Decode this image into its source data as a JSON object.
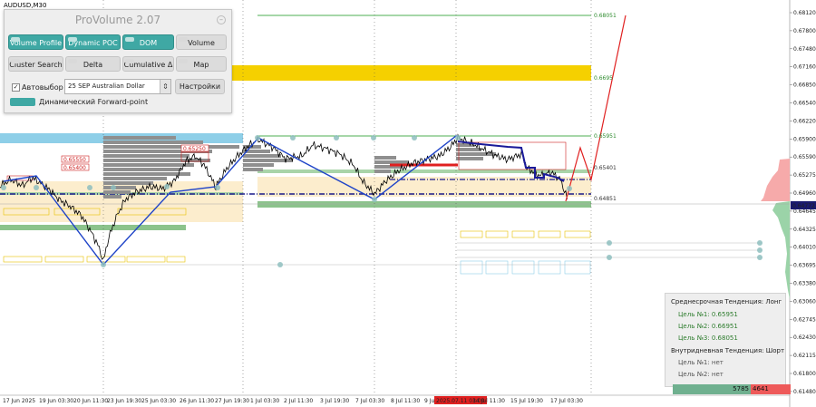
{
  "symbol": "AUDUSD,M30",
  "panel": {
    "title": "ProVolume 2.07",
    "buttons": [
      {
        "label": "Volume Profile",
        "style": "teal"
      },
      {
        "label": "Dynamic POC",
        "style": "teal"
      },
      {
        "label": "DOM",
        "style": "teal"
      },
      {
        "label": "Volume",
        "style": "gray"
      },
      {
        "label": "Cluster Search",
        "style": "gray"
      },
      {
        "label": "Delta",
        "style": "gray"
      },
      {
        "label": "Cumulative Δ",
        "style": "gray"
      },
      {
        "label": "Map",
        "style": "gray"
      }
    ],
    "auto_select_label": "Автовыбор",
    "auto_select_checked": true,
    "contract_value": "25 SEP Australian Dollar",
    "settings_label": "Настройки",
    "forward_point_label": "Динамический Forward-point"
  },
  "price_axis": {
    "ticks": [
      "0.68120",
      "0.67800",
      "0.67480",
      "0.67160",
      "0.66850",
      "0.66540",
      "0.66220",
      "0.65900",
      "0.65590",
      "0.65275",
      "0.64960",
      "0.64645",
      "0.64325",
      "0.64010",
      "0.63695",
      "0.63380",
      "0.63060",
      "0.62745",
      "0.62430",
      "0.62115",
      "0.61800",
      "0.61480"
    ],
    "current_price": "0.64772",
    "current_price_color": "#1a1a6e"
  },
  "time_axis": {
    "ticks": [
      "17 Jun 2025",
      "19 Jun 03:30",
      "20 Jun 11:30",
      "23 Jun 19:30",
      "25 Jun 03:30",
      "26 Jun 11:30",
      "27 Jun 19:30",
      "1 Jul 03:30",
      "2 Jul 11:30",
      "3 Jul 19:30",
      "7 Jul 03:30",
      "8 Jul 11:30",
      "9 Jul 19:30",
      "2025.07.11 03:00",
      "14 Jul 11:30",
      "15 Jul 19:30",
      "17 Jul 03:30"
    ],
    "highlighted_tick": "2025.07.11 03:00"
  },
  "levels": [
    {
      "label": "0.68051",
      "color": "#2e8b2e"
    },
    {
      "label": "0.6695",
      "color": "#2e8b2e"
    },
    {
      "label": "0.65951",
      "color": "#2e8b2e"
    },
    {
      "label": "0.65401",
      "color": "#333333"
    },
    {
      "label": "0.64851",
      "color": "#333333"
    }
  ],
  "profile_labels": [
    "0.65550",
    "0.65400",
    "0.65250"
  ],
  "trend": {
    "medium_title": "Среднесрочная Тенденция: Лонг",
    "medium_targets": [
      "Цель №1: 0.65951",
      "Цель №2: 0.66951",
      "Цель №3: 0.68051"
    ],
    "intraday_title": "Внутридневная Тенденция: Шорт",
    "intraday_targets": [
      "Цель №1: нет",
      "Цель №2: нет"
    ]
  },
  "volume_bar": {
    "buy": "5785",
    "sell": "4641"
  },
  "colors": {
    "buy": "#6fb08f",
    "sell": "#ee5a5a",
    "accent": "#3fa8a4",
    "zone_yellow": "#f5d000",
    "zone_blue": "#8ecfe8",
    "zigzag": "#1f44c8",
    "forecast": "#e02020"
  }
}
